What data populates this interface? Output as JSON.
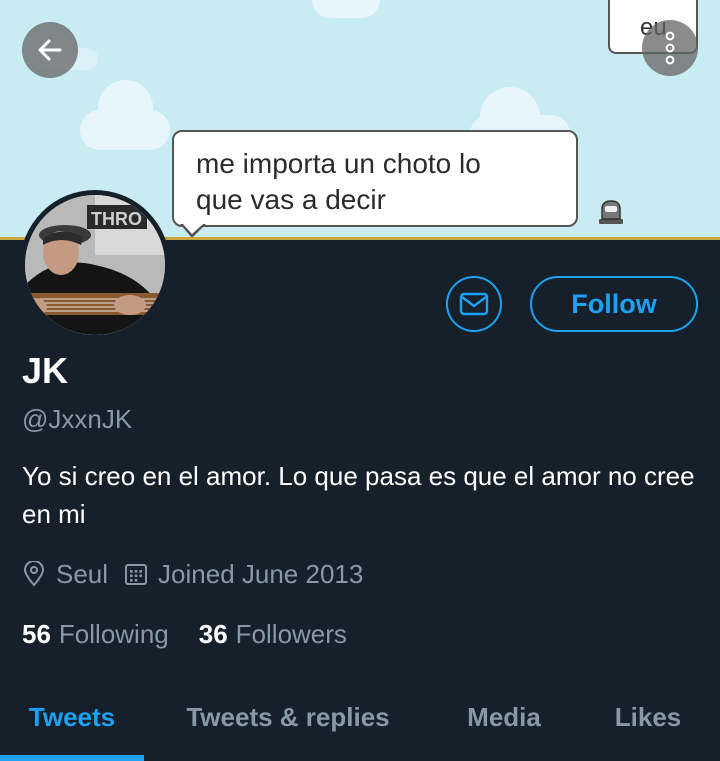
{
  "banner": {
    "speech_text_line1": "me importa un choto lo",
    "speech_text_line2": "que vas a decir",
    "small_bubble_text": "eu"
  },
  "nav": {
    "back_icon": "arrow-left-icon",
    "more_icon": "more-vertical-icon"
  },
  "actions": {
    "message_icon": "envelope-icon",
    "follow_label": "Follow"
  },
  "profile": {
    "display_name": "JK",
    "handle": "@JxxnJK",
    "bio": "Yo si creo en el amor. Lo que pasa es que el amor no cree en mi",
    "location": "Seul",
    "joined": "Joined June 2013"
  },
  "stats": {
    "following_count": "56",
    "following_label": "Following",
    "followers_count": "36",
    "followers_label": "Followers"
  },
  "tabs": [
    {
      "label": "Tweets",
      "active": true
    },
    {
      "label": "Tweets & replies",
      "active": false
    },
    {
      "label": "Media",
      "active": false
    },
    {
      "label": "Likes",
      "active": false
    }
  ],
  "colors": {
    "background": "#15202b",
    "accent": "#1da1f2",
    "secondary_text": "#8899a6",
    "banner_sky": "#c9ecf3"
  }
}
